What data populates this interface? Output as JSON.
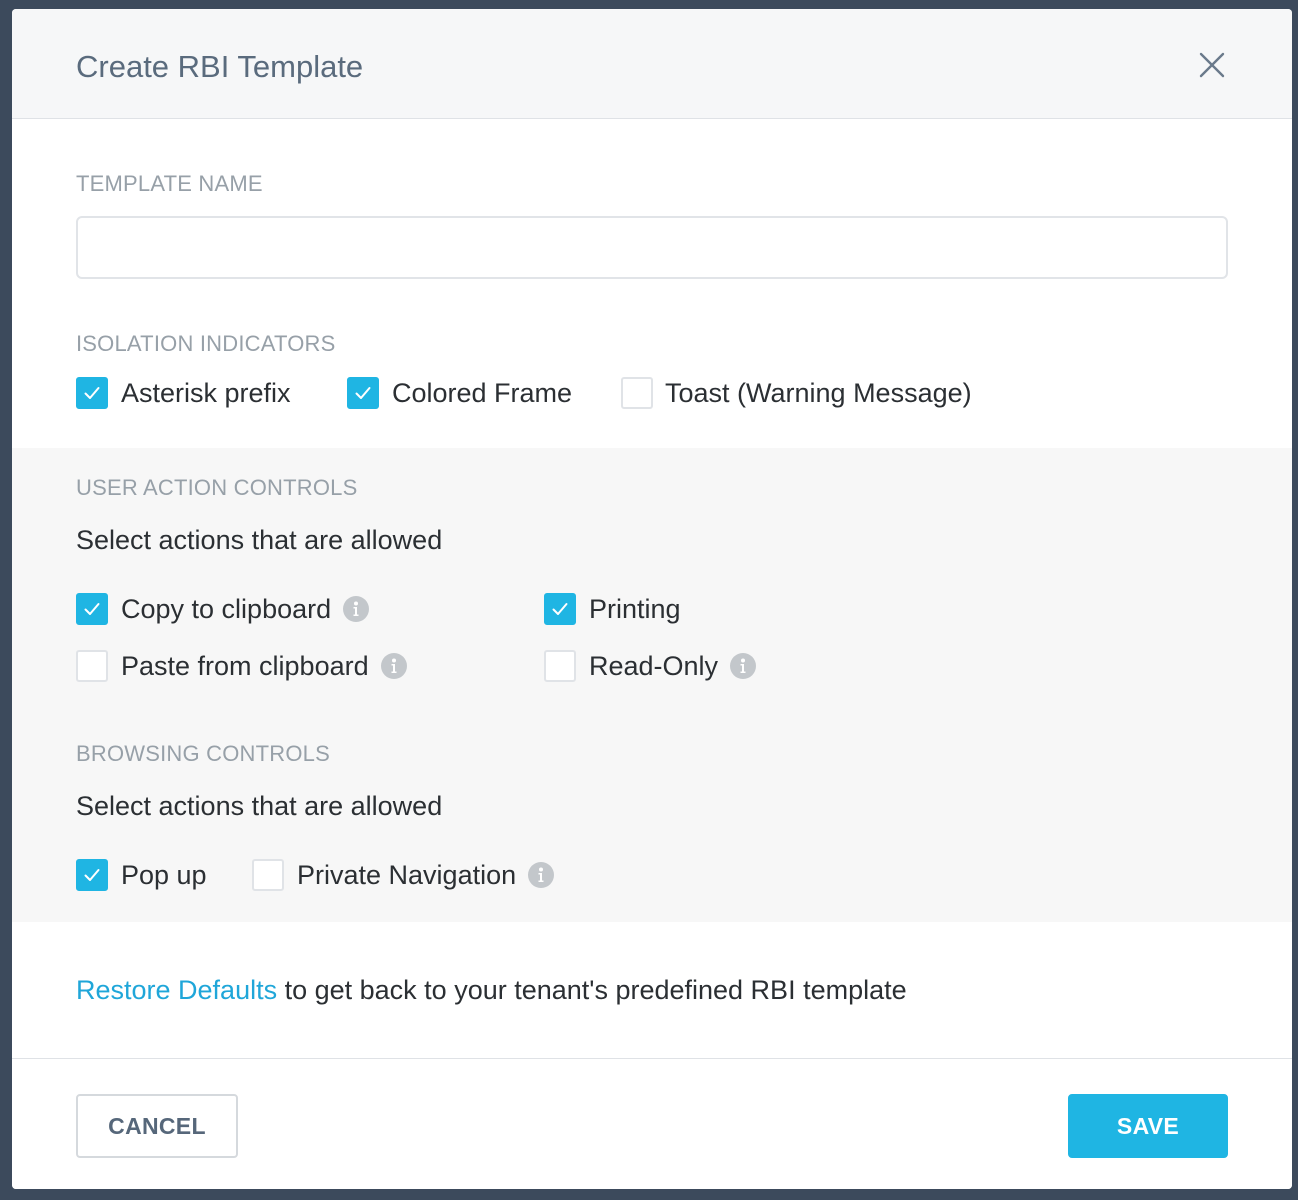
{
  "dialog": {
    "title": "Create RBI Template",
    "close_icon": "close-icon"
  },
  "template_name": {
    "label": "TEMPLATE NAME",
    "value": "",
    "placeholder": ""
  },
  "isolation_indicators": {
    "label": "ISOLATION INDICATORS",
    "options": [
      {
        "label": "Asterisk prefix",
        "checked": true
      },
      {
        "label": "Colored Frame",
        "checked": true
      },
      {
        "label": "Toast (Warning Message)",
        "checked": false
      }
    ]
  },
  "user_action_controls": {
    "label": "USER ACTION CONTROLS",
    "helper": "Select actions that are allowed",
    "options": [
      {
        "label": "Copy to clipboard",
        "checked": true,
        "info": true
      },
      {
        "label": "Printing",
        "checked": true,
        "info": false
      },
      {
        "label": "Paste from clipboard",
        "checked": false,
        "info": true
      },
      {
        "label": "Read-Only",
        "checked": false,
        "info": true
      }
    ]
  },
  "browsing_controls": {
    "label": "BROWSING CONTROLS",
    "helper": "Select actions that are allowed",
    "options": [
      {
        "label": "Pop up",
        "checked": true,
        "info": false
      },
      {
        "label": "Private Navigation",
        "checked": false,
        "info": true
      }
    ]
  },
  "restore": {
    "link": "Restore Defaults",
    "text": " to get back to your tenant's predefined RBI template"
  },
  "footer": {
    "cancel_label": "CANCEL",
    "save_label": "SAVE"
  },
  "colors": {
    "accent": "#1fb5e3",
    "link": "#1fa6d9",
    "backdrop": "#3c4a5c",
    "title": "#5a6b7d",
    "section_label": "#97a0a8"
  }
}
